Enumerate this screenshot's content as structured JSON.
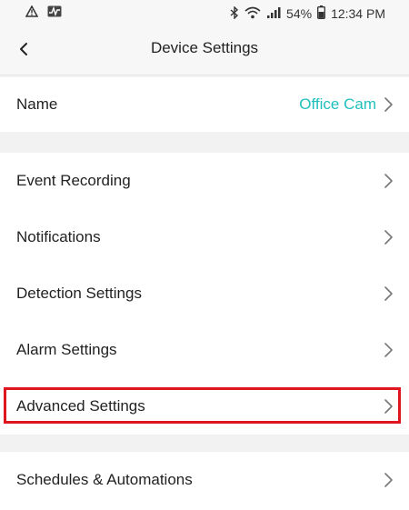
{
  "status_bar": {
    "battery_percent": "54%",
    "time": "12:34 PM",
    "icons": [
      "warning-icon",
      "activity-icon",
      "bluetooth-icon",
      "wifi-icon",
      "signal-icon",
      "battery-icon"
    ]
  },
  "header": {
    "title": "Device Settings",
    "back_icon": "chevron-left-icon"
  },
  "name_row": {
    "label": "Name",
    "value": "Office Cam"
  },
  "settings": [
    {
      "label": "Event Recording"
    },
    {
      "label": "Notifications"
    },
    {
      "label": "Detection Settings"
    },
    {
      "label": "Alarm Settings"
    },
    {
      "label": "Advanced Settings",
      "highlighted": true
    }
  ],
  "automations_row": {
    "label": "Schedules & Automations"
  },
  "colors": {
    "accent": "#20c0bd",
    "highlight_border": "#e0161e",
    "background": "#f2f2f2"
  }
}
